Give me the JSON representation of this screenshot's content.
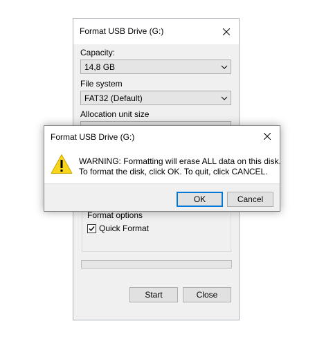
{
  "format_dialog": {
    "title": "Format USB Drive (G:)",
    "capacity_label": "Capacity:",
    "capacity_value": "14,8 GB",
    "filesystem_label": "File system",
    "filesystem_value": "FAT32 (Default)",
    "allocation_label": "Allocation unit size",
    "format_options_label": "Format options",
    "quick_format_label": "Quick Format",
    "quick_format_checked": true,
    "progress": 0,
    "start_label": "Start",
    "close_label": "Close",
    "icons": [
      "close-icon",
      "chevron-down-icon",
      "checkmark-icon"
    ]
  },
  "warning_dialog": {
    "title": "Format USB Drive (G:)",
    "message_line1": "WARNING: Formatting will erase ALL data on this disk.",
    "message_line2": "To format the disk, click OK. To quit, click CANCEL.",
    "ok_label": "OK",
    "cancel_label": "Cancel",
    "icon": "warning-icon",
    "colors": {
      "warning_fill": "#f8d51b",
      "focus_border": "#0078d7"
    }
  }
}
